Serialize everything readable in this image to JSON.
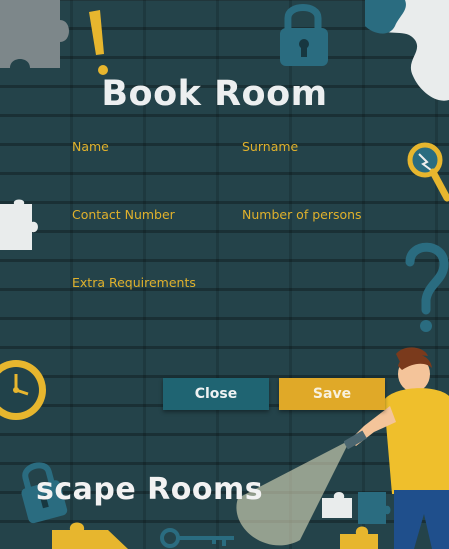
{
  "form": {
    "title": "Book Room",
    "fields": {
      "name": {
        "label": "Name",
        "value": ""
      },
      "surname": {
        "label": "Surname",
        "value": ""
      },
      "contact_number": {
        "label": "Contact Number",
        "value": ""
      },
      "persons": {
        "label": "Number of persons",
        "value": ""
      },
      "extra": {
        "label": "Extra Requirements",
        "value": ""
      }
    },
    "close_label": "Close",
    "save_label": "Save"
  },
  "brand": {
    "text": "scape Rooms"
  },
  "colors": {
    "background": "#1f3a40",
    "label": "#e0b12c",
    "close_button": "#1f6472",
    "save_button": "#e0a928"
  },
  "icons": [
    "puzzle-piece-icon",
    "padlock-icon",
    "magnifier-icon",
    "clock-icon",
    "question-mark-icon",
    "key-icon",
    "explorer-character"
  ]
}
